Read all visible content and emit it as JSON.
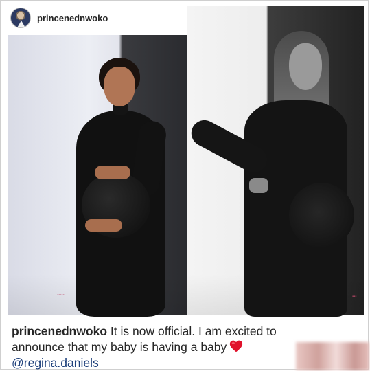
{
  "post": {
    "username": "princenednwoko",
    "caption": {
      "username": "princenednwoko",
      "text": " It is now official. I am excited to announce that my baby is having a baby",
      "mention": "@regina.daniels"
    },
    "images": [
      {
        "name": "left-photo"
      },
      {
        "name": "right-photo"
      }
    ]
  },
  "icons": {
    "heart": "red-heart-emoji",
    "avatar": "profile-avatar"
  },
  "colors": {
    "heart": "#e0112b",
    "mention": "#1d3f7a",
    "text": "#262626"
  }
}
